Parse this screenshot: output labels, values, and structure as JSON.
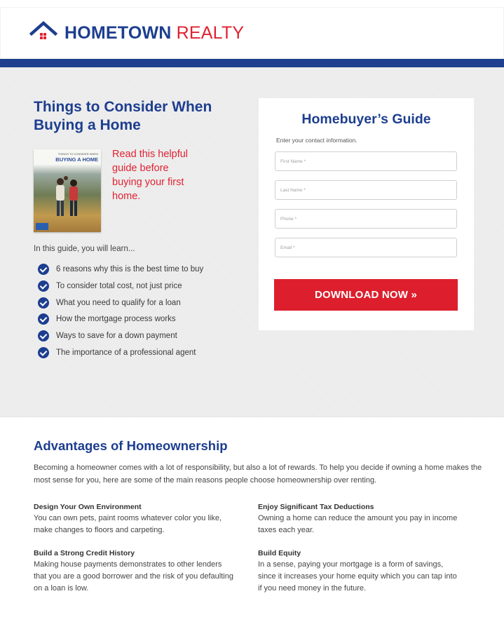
{
  "brand": {
    "name_bold": "HOMETOWN",
    "name_light": "REALTY"
  },
  "colors": {
    "brand_blue": "#1d3e8f",
    "brand_red": "#dd1f2d",
    "hero_bg": "#eeeeee"
  },
  "hero": {
    "title": "Things to Consider When Buying a Home",
    "guide_text": "Read this helpful guide before buying your first home.",
    "book": {
      "small_line": "THINGS TO CONSIDER WHEN",
      "title": "BUYING A HOME"
    },
    "learn_intro": "In this guide, you will learn...",
    "checklist": [
      "6 reasons why this is the best time to buy",
      "To consider total cost, not just price",
      "What you need to qualify for a loan",
      "How the mortgage process works",
      "Ways to save for a down payment",
      "The importance of a professional agent"
    ]
  },
  "form": {
    "title": "Homebuyer’s Guide",
    "subtitle": "Enter your contact information.",
    "fields": {
      "first_name": "First Name *",
      "last_name": "Last Name *",
      "phone": "Phone *",
      "email": "Email *"
    },
    "submit_label": "DOWNLOAD NOW »"
  },
  "advantages": {
    "title": "Advantages of Homeownership",
    "intro": "Becoming a homeowner comes with a lot of responsibility, but also a lot of rewards. To help you decide if owning a home makes the most sense for you, here are some of the main reasons people choose homeownership over renting.",
    "items": [
      {
        "heading": "Design Your Own Environment",
        "body": "You can own pets, paint rooms whatever color you like, make changes to floors and carpeting."
      },
      {
        "heading": "Enjoy Significant Tax Deductions",
        "body": "Owning a home can reduce the amount you pay in income taxes each year."
      },
      {
        "heading": "Build a Strong Credit History",
        "body": "Making house payments demonstrates to other lenders that you are a good borrower and the risk of you defaulting on a loan is low."
      },
      {
        "heading": "Build Equity",
        "body": "In a sense, paying your mortgage is a form of savings, since it increases your home equity which you can tap into if you need money in the future."
      }
    ]
  }
}
